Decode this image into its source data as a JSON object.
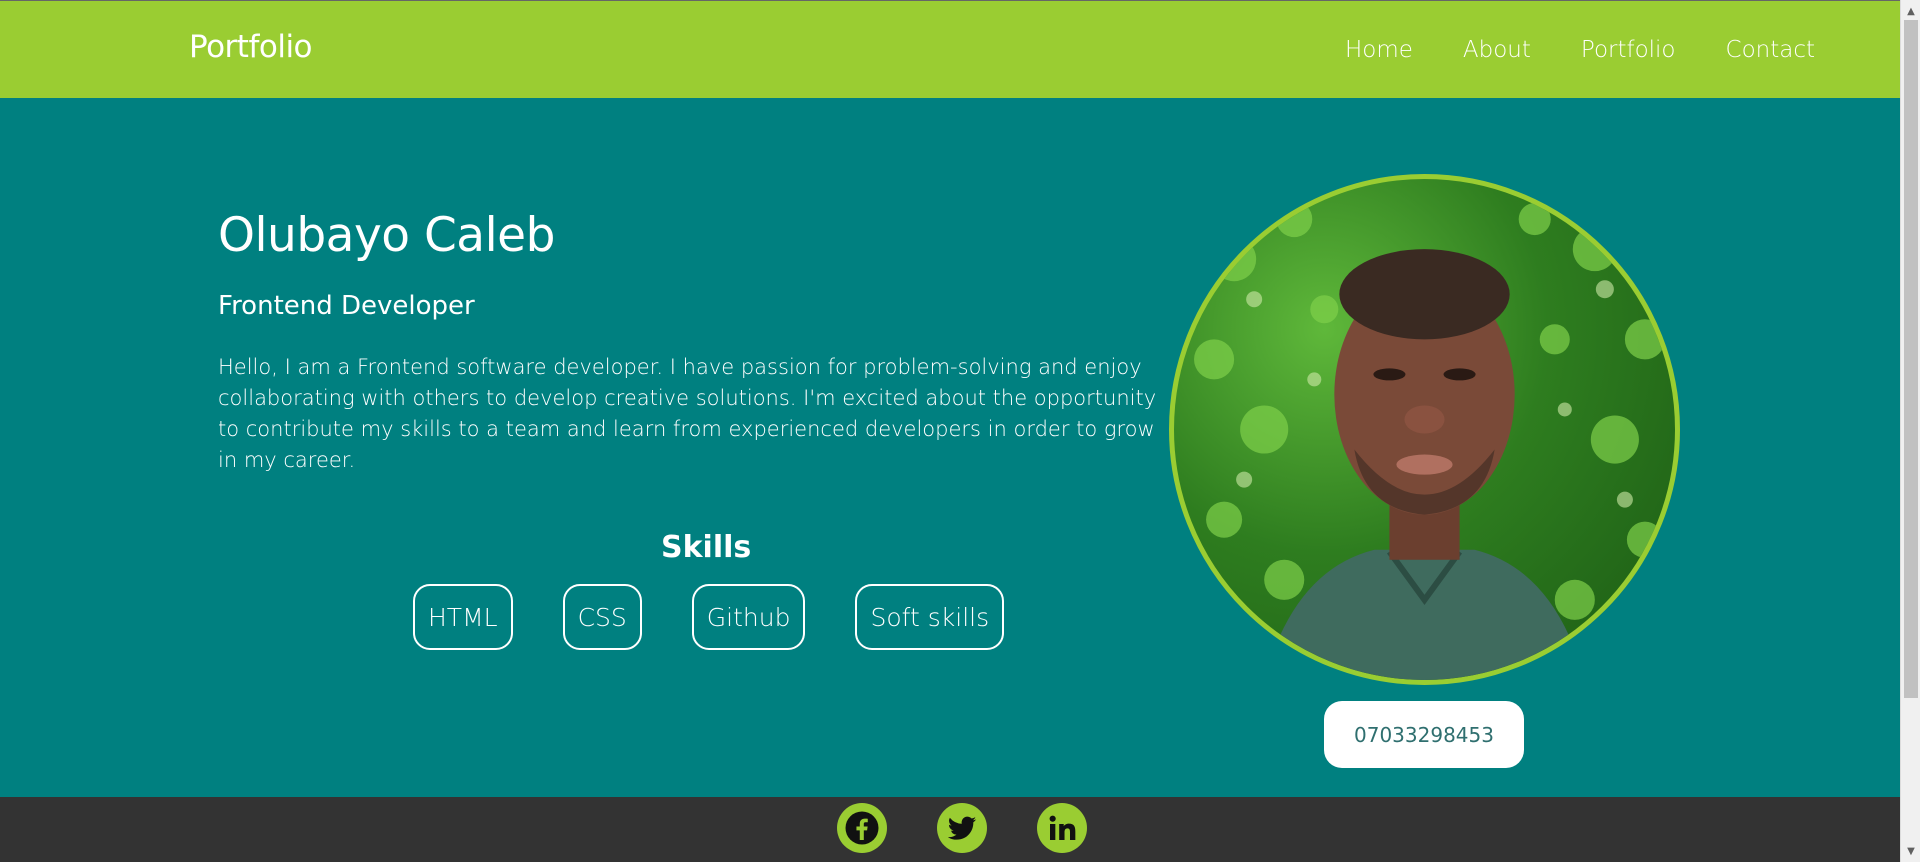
{
  "header": {
    "logo": "Portfolio",
    "nav": [
      "Home",
      "About",
      "Portfolio",
      "Contact"
    ]
  },
  "hero": {
    "name": "Olubayo Caleb",
    "role": "Frontend Developer",
    "bio": "Hello, I am a Frontend software developer. I have passion for problem-solving and enjoy collaborating with others to develop creative solutions. I'm excited about the opportunity to contribute my skills to a team and learn from experienced developers in order to grow in my career.",
    "skills_title": "Skills",
    "skills": [
      "HTML",
      "CSS",
      "Github",
      "Soft skills"
    ]
  },
  "contact": {
    "phone": "07033298453"
  },
  "footer": {
    "social_icons": [
      "facebook-icon",
      "twitter-icon",
      "linkedin-icon"
    ]
  },
  "colors": {
    "accent": "#9acd32",
    "background": "#008080",
    "footer": "#333333"
  }
}
